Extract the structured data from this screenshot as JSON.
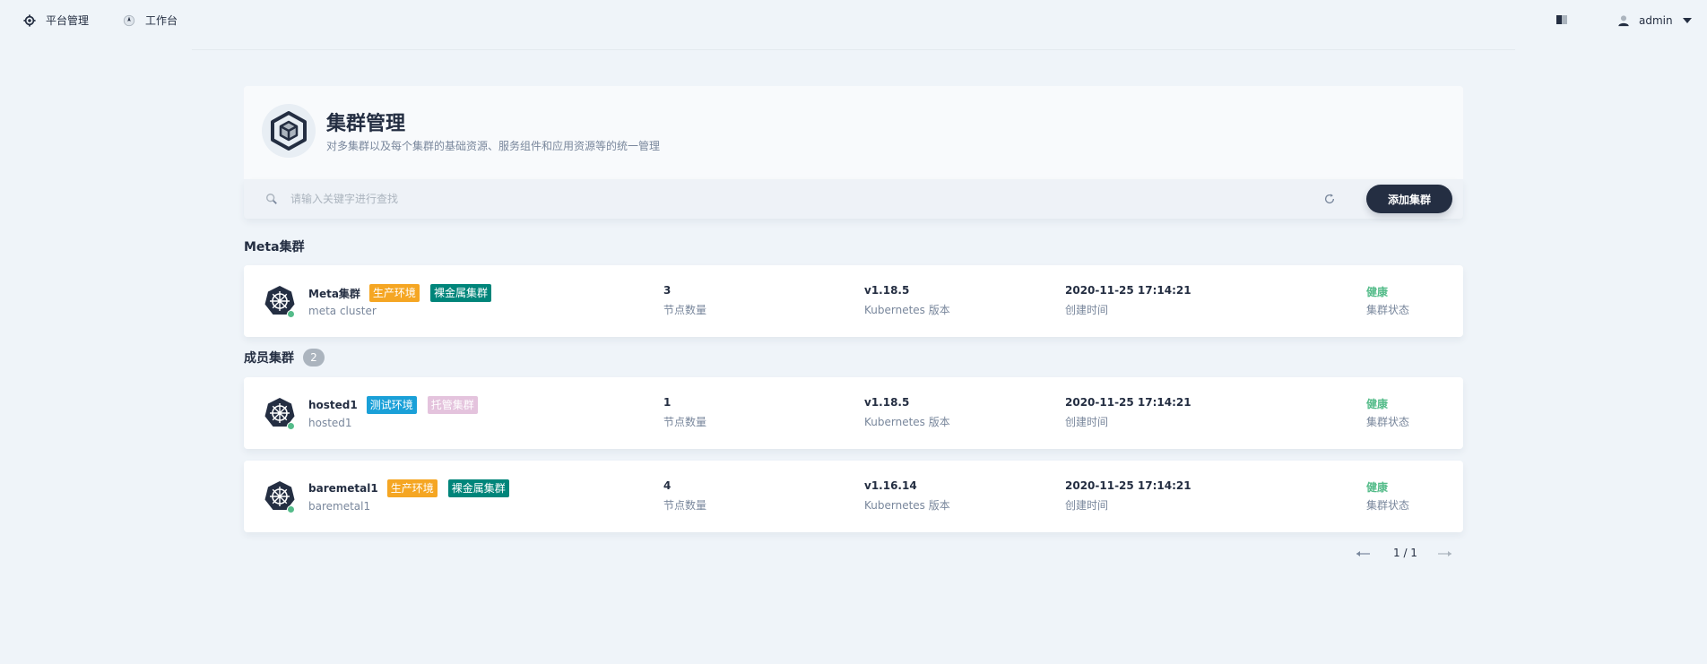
{
  "nav": {
    "platform_label": "平台管理",
    "workbench_label": "工作台",
    "user_label": "admin"
  },
  "banner": {
    "title": "集群管理",
    "description": "对多集群以及每个集群的基础资源、服务组件和应用资源等的统一管理"
  },
  "toolbar": {
    "search_placeholder": "请输入关键字进行查找",
    "add_button_label": "添加集群"
  },
  "sections": {
    "meta_title": "Meta集群",
    "member_title": "成员集群",
    "member_count": "2"
  },
  "clusters": [
    {
      "name": "Meta集群",
      "description": "meta cluster",
      "tags": [
        {
          "label": "生产环境",
          "color": "#f5a623"
        },
        {
          "label": "裸金属集群",
          "color": "#00857a"
        }
      ],
      "nodes": "3",
      "nodes_label": "节点数量",
      "version": "v1.18.5",
      "version_label": "Kubernetes 版本",
      "created": "2020-11-25 17:14:21",
      "created_label": "创建时间",
      "status": "健康",
      "status_label": "集群状态"
    },
    {
      "name": "hosted1",
      "description": "hosted1",
      "tags": [
        {
          "label": "测试环境",
          "color": "#1aa0d8"
        },
        {
          "label": "托管集群",
          "color": "#e4c3dd"
        }
      ],
      "nodes": "1",
      "nodes_label": "节点数量",
      "version": "v1.18.5",
      "version_label": "Kubernetes 版本",
      "created": "2020-11-25 17:14:21",
      "created_label": "创建时间",
      "status": "健康",
      "status_label": "集群状态"
    },
    {
      "name": "baremetal1",
      "description": "baremetal1",
      "tags": [
        {
          "label": "生产环境",
          "color": "#f5a623"
        },
        {
          "label": "裸金属集群",
          "color": "#00857a"
        }
      ],
      "nodes": "4",
      "nodes_label": "节点数量",
      "version": "v1.16.14",
      "version_label": "Kubernetes 版本",
      "created": "2020-11-25 17:14:21",
      "created_label": "创建时间",
      "status": "健康",
      "status_label": "集群状态"
    }
  ],
  "pagination": {
    "text": "1 / 1"
  },
  "colors": {
    "background": "#eff4f9",
    "primary_dark": "#242e42",
    "healthy": "#55bc8a",
    "muted": "#79879c"
  }
}
